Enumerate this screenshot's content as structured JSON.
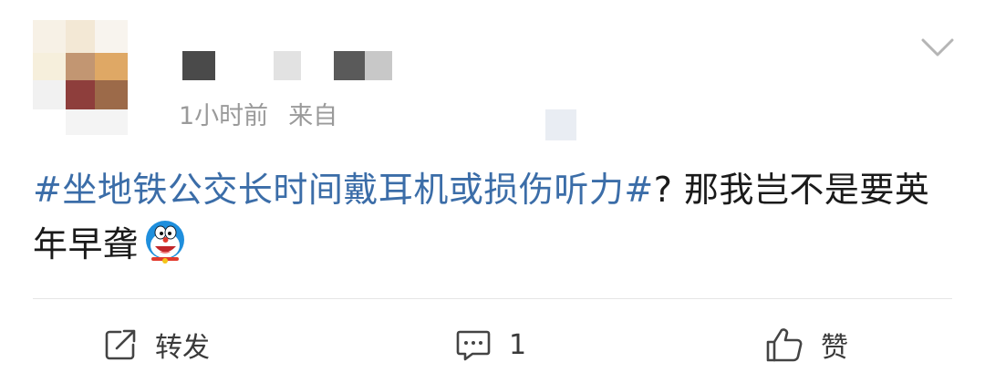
{
  "post": {
    "time": "1小时前",
    "source_prefix": "来自",
    "content": {
      "topic": "#坐地铁公交长时间戴耳机或损伤听力#",
      "text": "? 那我岂不是要英年早聋"
    },
    "emoji_icon": "doraemon-emoji-icon"
  },
  "actions": {
    "repost_label": "转发",
    "comment_count": "1",
    "like_label": "赞"
  },
  "colors": {
    "topic_link": "#3b6da8",
    "meta_text": "#9a9a9a",
    "body_text": "#1a1a1a"
  }
}
